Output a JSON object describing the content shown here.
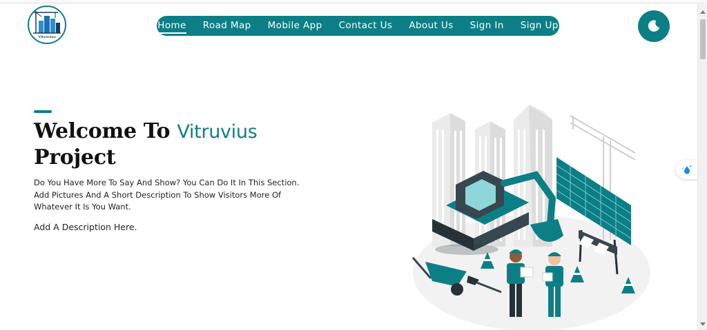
{
  "logo": {
    "text": "Vitruvius"
  },
  "nav": {
    "items": [
      {
        "label": "Home",
        "active": true
      },
      {
        "label": "Road Map",
        "active": false
      },
      {
        "label": "Mobile App",
        "active": false
      },
      {
        "label": "Contact Us",
        "active": false
      },
      {
        "label": "About Us",
        "active": false
      },
      {
        "label": "Sign In",
        "active": false
      },
      {
        "label": "Sign Up",
        "active": false
      }
    ]
  },
  "theme_toggle": {
    "icon": "moon-icon"
  },
  "side_widget": {
    "icon": "water-drop-sparkle-icon"
  },
  "hero": {
    "title_prefix": "Welcome To",
    "title_brand": "Vitruvius",
    "title_suffix": "Project",
    "description": "Do You Have More To Say And Show? You Can Do It In This Section. Add Pictures And A Short Description To Show Visitors More Of Whatever It Is You Want.",
    "note": "Add A Description Here."
  },
  "colors": {
    "accent": "#0c7f86",
    "text": "#111111",
    "background": "#ffffff"
  }
}
